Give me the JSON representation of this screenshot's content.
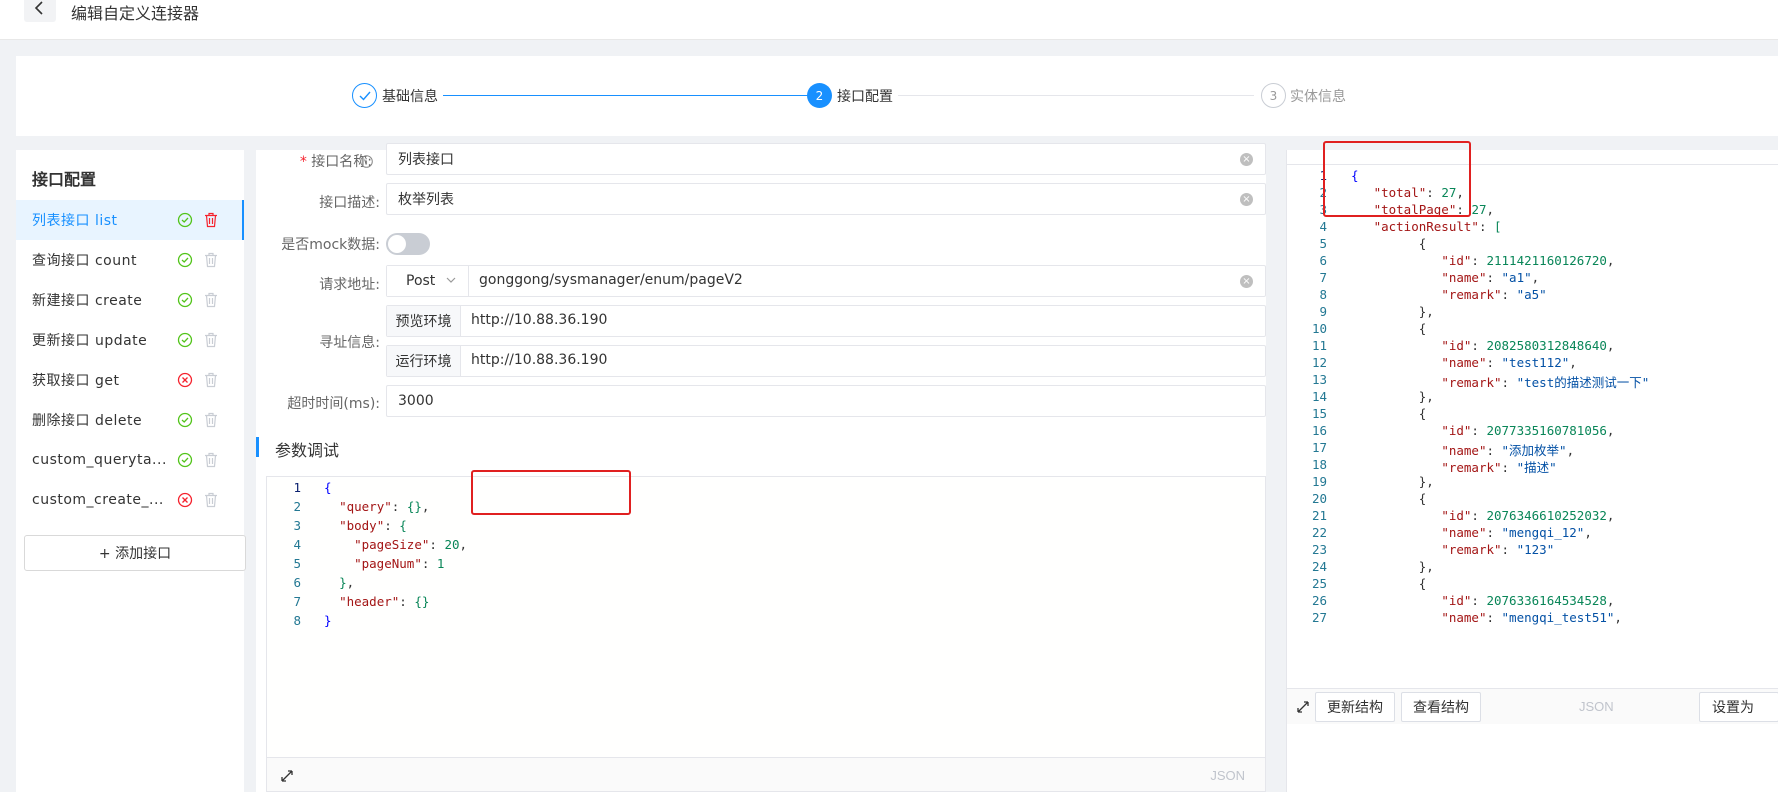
{
  "header": {
    "title": "编辑自定义连接器",
    "back_icon": "chevron-left-icon"
  },
  "steps": [
    {
      "number": "1",
      "label": "基础信息",
      "status": "done"
    },
    {
      "number": "2",
      "label": "接口配置",
      "status": "active"
    },
    {
      "number": "3",
      "label": "实体信息",
      "status": "pending"
    }
  ],
  "colors": {
    "primary": "#1890ff",
    "success": "#52c41a",
    "error": "#f5222d",
    "highlight": "#e02020"
  },
  "sidebar": {
    "title": "接口配置",
    "items": [
      {
        "label": "列表接口 list",
        "status": "ok",
        "active": true
      },
      {
        "label": "查询接口 count",
        "status": "ok"
      },
      {
        "label": "新建接口 create",
        "status": "ok"
      },
      {
        "label": "更新接口 update",
        "status": "ok"
      },
      {
        "label": "获取接口 get",
        "status": "error"
      },
      {
        "label": "删除接口 delete",
        "status": "ok"
      },
      {
        "label": "custom_queryta...",
        "status": "ok"
      },
      {
        "label": "custom_create_...",
        "status": "error"
      }
    ],
    "add_button": "+ 添加接口"
  },
  "form": {
    "name_label": "接口名称:",
    "name_value": "列表接口",
    "desc_label": "接口描述:",
    "desc_value": "枚举列表",
    "mock_label": "是否mock数据:",
    "mock_on": false,
    "url_label": "请求地址:",
    "method": "Post",
    "url_value": "gonggong/sysmanager/enum/pageV2",
    "addr_label": "寻址信息:",
    "env_preview_label": "预览环境",
    "env_preview_value": "http://10.88.36.190",
    "env_run_label": "运行环境",
    "env_run_value": "http://10.88.36.190",
    "timeout_label": "超时时间(ms):",
    "timeout_value": "3000"
  },
  "debug": {
    "section_title": "参数调试",
    "lines": [
      "1",
      "2",
      "3",
      "4",
      "5",
      "6",
      "7",
      "8"
    ],
    "json_tag": "JSON"
  },
  "response": {
    "lines": [
      "1",
      "2",
      "3",
      "4",
      "5",
      "6",
      "7",
      "8",
      "9",
      "10",
      "11",
      "12",
      "13",
      "14",
      "15",
      "16",
      "17",
      "18",
      "19",
      "20",
      "21",
      "22",
      "23",
      "24",
      "25",
      "26",
      "27"
    ],
    "buttons": {
      "update": "更新结构",
      "view": "查看结构",
      "set": "设置为"
    },
    "json_tag": "JSON"
  }
}
